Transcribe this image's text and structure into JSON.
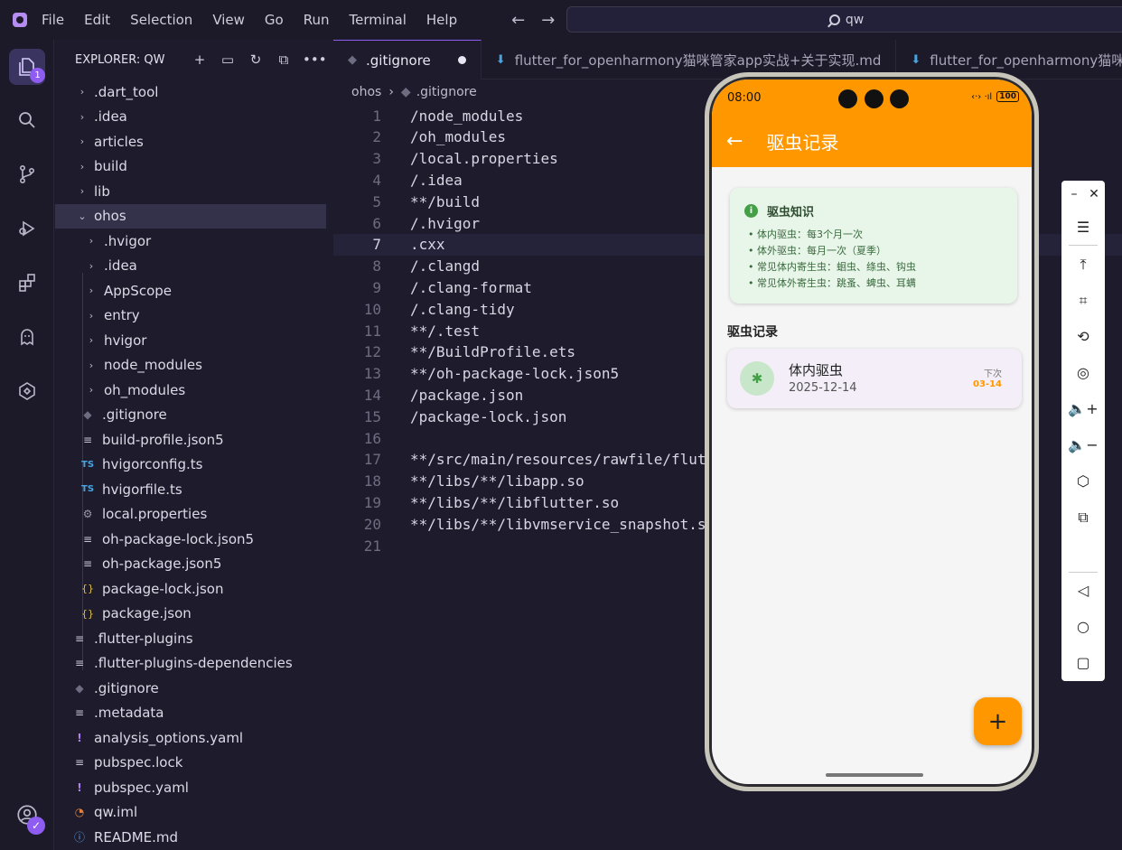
{
  "titlebar": {
    "menu": [
      "File",
      "Edit",
      "Selection",
      "View",
      "Go",
      "Run",
      "Terminal",
      "Help"
    ],
    "search": "qw"
  },
  "activitybar": {
    "badge_count": "1",
    "icons": [
      "explorer-icon",
      "search-icon",
      "source-control-icon",
      "run-debug-icon",
      "extensions-icon",
      "ghost-icon",
      "harmony-icon",
      "account-icon"
    ]
  },
  "sidebar": {
    "title": "EXPLORER: QW",
    "items": [
      {
        "label": ".dart_tool",
        "type": "folder",
        "level": 0
      },
      {
        "label": ".idea",
        "type": "folder",
        "level": 0
      },
      {
        "label": "articles",
        "type": "folder",
        "level": 0
      },
      {
        "label": "build",
        "type": "folder",
        "level": 0
      },
      {
        "label": "lib",
        "type": "folder",
        "level": 0
      },
      {
        "label": "ohos",
        "type": "folder-open",
        "level": 0
      },
      {
        "label": ".hvigor",
        "type": "folder",
        "level": 1
      },
      {
        "label": ".idea",
        "type": "folder",
        "level": 1
      },
      {
        "label": "AppScope",
        "type": "folder",
        "level": 1
      },
      {
        "label": "entry",
        "type": "folder",
        "level": 1
      },
      {
        "label": "hvigor",
        "type": "folder",
        "level": 1
      },
      {
        "label": "node_modules",
        "type": "folder",
        "level": 1
      },
      {
        "label": "oh_modules",
        "type": "folder",
        "level": 1
      },
      {
        "label": ".gitignore",
        "type": "git",
        "level": 1
      },
      {
        "label": "build-profile.json5",
        "type": "list",
        "level": 1
      },
      {
        "label": "hvigorconfig.ts",
        "type": "ts",
        "level": 1
      },
      {
        "label": "hvigorfile.ts",
        "type": "ts",
        "level": 1
      },
      {
        "label": "local.properties",
        "type": "gear",
        "level": 1
      },
      {
        "label": "oh-package-lock.json5",
        "type": "list",
        "level": 1
      },
      {
        "label": "oh-package.json5",
        "type": "list",
        "level": 1
      },
      {
        "label": "package-lock.json",
        "type": "json",
        "level": 1
      },
      {
        "label": "package.json",
        "type": "json",
        "level": 1
      },
      {
        "label": ".flutter-plugins",
        "type": "list",
        "level": 0
      },
      {
        "label": ".flutter-plugins-dependencies",
        "type": "list",
        "level": 0
      },
      {
        "label": ".gitignore",
        "type": "git",
        "level": 0
      },
      {
        "label": ".metadata",
        "type": "list",
        "level": 0
      },
      {
        "label": "analysis_options.yaml",
        "type": "yaml",
        "level": 0
      },
      {
        "label": "pubspec.lock",
        "type": "list",
        "level": 0
      },
      {
        "label": "pubspec.yaml",
        "type": "yaml",
        "level": 0
      },
      {
        "label": "qw.iml",
        "type": "rss",
        "level": 0
      },
      {
        "label": "README.md",
        "type": "info",
        "level": 0
      }
    ]
  },
  "editor": {
    "tabs": [
      {
        "label": ".gitignore",
        "active": true,
        "modified": true
      },
      {
        "label": "flutter_for_openharmony猫咪管家app实战+关于实现.md",
        "active": false
      },
      {
        "label": "flutter_for_openharmony猫咪",
        "active": false
      }
    ],
    "breadcrumb": [
      "ohos",
      ".gitignore"
    ],
    "current_line": 7,
    "lines": [
      "/node_modules",
      "/oh_modules",
      "/local.properties",
      "/.idea",
      "**/build",
      "/.hvigor",
      ".cxx",
      "/.clangd",
      "/.clang-format",
      "/.clang-tidy",
      "**/.test",
      "**/BuildProfile.ets",
      "**/oh-package-lock.json5",
      "/package.json",
      "/package-lock.json",
      "",
      "**/src/main/resources/rawfile/flut",
      "**/libs/**/libapp.so",
      "**/libs/**/libflutter.so",
      "**/libs/**/libvmservice_snapshot.s",
      ""
    ]
  },
  "phone": {
    "status_time": "08:00",
    "status_battery": "100",
    "appbar_title": "驱虫记录",
    "info_title": "驱虫知识",
    "info_lines": [
      "• 体内驱虫：每3个月一次",
      "• 体外驱虫：每月一次（夏季）",
      "• 常见体内寄生虫：蛔虫、绦虫、钩虫",
      "• 常见体外寄生虫：跳蚤、蜱虫、耳螨"
    ],
    "section_title": "驱虫记录",
    "record": {
      "name": "体内驱虫",
      "date": "2025-12-14",
      "next_label": "下次",
      "next_date": "03-14"
    },
    "fab": "+"
  },
  "colors": {
    "accent": "#8e5cf0",
    "appbar": "#ff9800",
    "info_card": "#e8f5e9"
  }
}
